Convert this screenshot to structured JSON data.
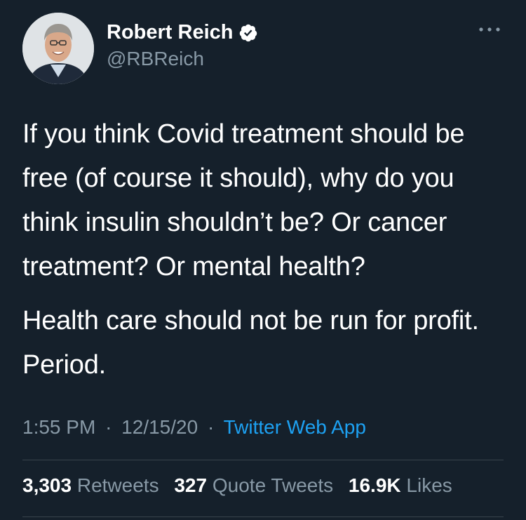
{
  "author": {
    "display_name": "Robert Reich",
    "handle": "@RBReich",
    "verified": true,
    "avatar": "profile-photo"
  },
  "tweet": {
    "paragraphs": [
      "If you think Covid treatment should be free (of course it should), why do you think insulin shouldn’t be? Or cancer treatment? Or mental health?",
      "Health care should not be run for profit. Period."
    ]
  },
  "meta": {
    "time": "1:55 PM",
    "separator": "·",
    "date": "12/15/20",
    "source": "Twitter Web App"
  },
  "stats": {
    "retweets_count": "3,303",
    "retweets_label": "Retweets",
    "quote_tweets_count": "327",
    "quote_tweets_label": "Quote Tweets",
    "likes_count": "16.9K",
    "likes_label": "Likes"
  },
  "colors": {
    "background": "#15202b",
    "text": "#ffffff",
    "secondary": "#8899a6",
    "link": "#1da1f2",
    "divider": "#38444d"
  },
  "icons": {
    "verified": "verified-badge-icon",
    "more": "more-options-icon"
  }
}
